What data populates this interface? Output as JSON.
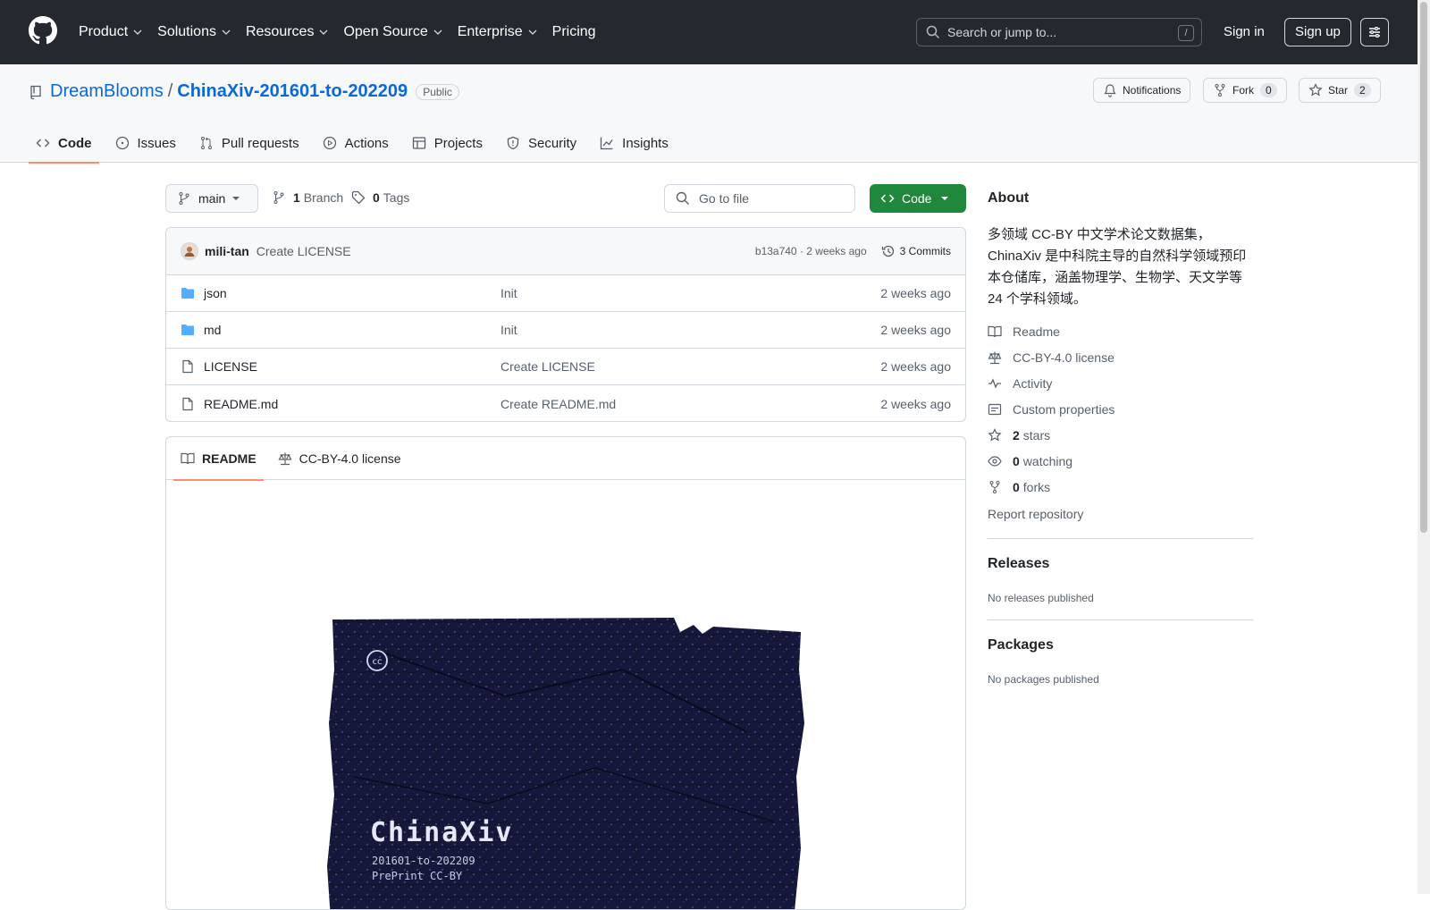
{
  "header": {
    "nav": [
      "Product",
      "Solutions",
      "Resources",
      "Open Source",
      "Enterprise",
      "Pricing"
    ],
    "search_placeholder": "Search or jump to...",
    "search_shortcut": "/",
    "signin": "Sign in",
    "signup": "Sign up"
  },
  "repo": {
    "owner": "DreamBlooms",
    "separator": "/",
    "name": "ChinaXiv-201601-to-202209",
    "visibility": "Public",
    "notifications": "Notifications",
    "fork_label": "Fork",
    "fork_count": "0",
    "star_label": "Star",
    "star_count": "2"
  },
  "tabs": [
    "Code",
    "Issues",
    "Pull requests",
    "Actions",
    "Projects",
    "Security",
    "Insights"
  ],
  "toolbar": {
    "branch": "main",
    "branch_count": "1",
    "branch_label": "Branch",
    "tag_count": "0",
    "tag_label": "Tags",
    "goto_placeholder": "Go to file",
    "code_button": "Code"
  },
  "commit": {
    "author": "mili-tan",
    "message": "Create LICENSE",
    "sha_time": "b13a740 · 2 weeks ago",
    "commits": "3 Commits"
  },
  "files": [
    {
      "name": "json",
      "message": "Init",
      "age": "2 weeks ago",
      "type": "dir"
    },
    {
      "name": "md",
      "message": "Init",
      "age": "2 weeks ago",
      "type": "dir"
    },
    {
      "name": "LICENSE",
      "message": "Create LICENSE",
      "age": "2 weeks ago",
      "type": "file"
    },
    {
      "name": "README.md",
      "message": "Create README.md",
      "age": "2 weeks ago",
      "type": "file"
    }
  ],
  "readme_tabs": [
    "README",
    "CC-BY-4.0 license"
  ],
  "cover": {
    "title": "ChinaXiv",
    "line1": "201601-to-202209",
    "line2": "PrePrint CC-BY",
    "cc": "cc"
  },
  "about": {
    "heading": "About",
    "description": "多领域 CC-BY 中文学术论文数据集，ChinaXiv 是中科院主导的自然科学领域预印本仓储库，涵盖物理学、生物学、天文学等 24 个学科领域。",
    "readme": "Readme",
    "license": "CC-BY-4.0 license",
    "activity": "Activity",
    "custom_properties": "Custom properties",
    "stars_count": "2",
    "stars_label": "stars",
    "watching_count": "0",
    "watching_label": "watching",
    "forks_count": "0",
    "forks_label": "forks",
    "report": "Report repository"
  },
  "releases": {
    "heading": "Releases",
    "note": "No releases published"
  },
  "packages": {
    "heading": "Packages",
    "note": "No packages published"
  },
  "colors": {
    "accent": "#0969da",
    "header_bg": "#24292f",
    "code_button": "#1f883d",
    "tab_underline": "#fd8c73",
    "folder": "#54aeff"
  }
}
